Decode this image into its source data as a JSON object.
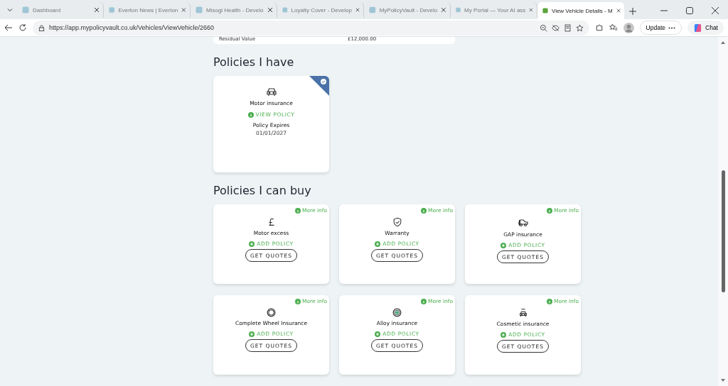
{
  "browser": {
    "tabs": [
      {
        "title": "Dashboard",
        "selected": false
      },
      {
        "title": "Everton News | Everton",
        "selected": false
      },
      {
        "title": "Misogi Health - Develo",
        "selected": false
      },
      {
        "title": "Loyalty Cover - Develop",
        "selected": false
      },
      {
        "title": "MyPolicyVault - Develo",
        "selected": false
      },
      {
        "title": "My Portal — Your AI ass",
        "selected": false
      },
      {
        "title": "View Vehicle Details - M",
        "selected": true
      }
    ],
    "address": "https://app.mypolicyvault.co.uk/Vehicles/ViewVehicle/2660",
    "update_label": "Update",
    "chat_label": "Chat"
  },
  "summary_row": {
    "label": "Residual Value",
    "value": "£12,000.00"
  },
  "owned_section": {
    "heading": "Policies I have",
    "policies": [
      {
        "name": "Motor insurance",
        "kind": "car",
        "action": "VIEW POLICY",
        "expires_label": "Policy Expires",
        "expires_date": "01/01/2027"
      }
    ]
  },
  "buy_section": {
    "heading": "Policies I can buy",
    "policies": [
      {
        "name": "Motor excess",
        "kind": "pound",
        "more_info": "More info",
        "action": "ADD POLICY",
        "button": "GET QUOTES"
      },
      {
        "name": "Warranty",
        "kind": "shield",
        "more_info": "More info",
        "action": "ADD POLICY",
        "button": "GET QUOTES"
      },
      {
        "name": "GAP insurance",
        "kind": "gap",
        "more_info": "More info",
        "action": "ADD POLICY",
        "button": "GET QUOTES"
      },
      {
        "name": "Complete Wheel Insurance",
        "kind": "wheel",
        "more_info": "More info",
        "action": "ADD POLICY",
        "button": "GET QUOTES"
      },
      {
        "name": "Alloy insurance",
        "kind": "alloy",
        "more_info": "More info",
        "action": "ADD POLICY",
        "button": "GET QUOTES"
      },
      {
        "name": "Cosmetic insurance",
        "kind": "cosmetic",
        "more_info": "More info",
        "action": "ADD POLICY",
        "button": "GET QUOTES"
      }
    ]
  }
}
